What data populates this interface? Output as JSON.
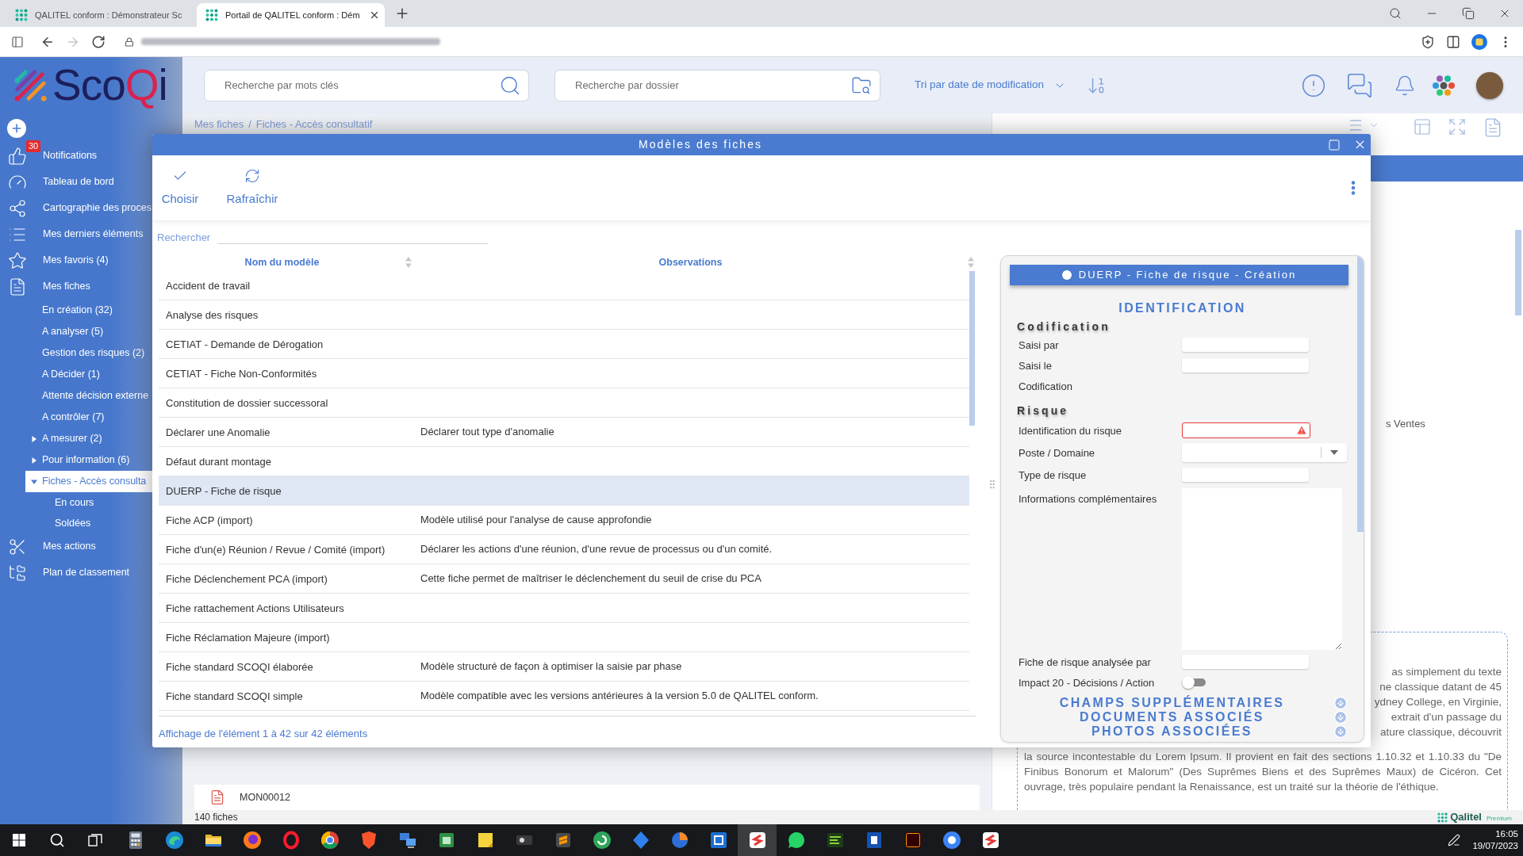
{
  "browser": {
    "tabs": [
      {
        "title": "QALITEL conform : Démonstrateur Sc",
        "selected": false
      },
      {
        "title": "Portail de QALITEL conform : Dém",
        "selected": true
      }
    ],
    "nav": [
      {
        "kind": "back",
        "disabled": false
      },
      {
        "kind": "forward",
        "disabled": true
      },
      {
        "kind": "reload",
        "disabled": false
      }
    ]
  },
  "header": {
    "logo": [
      {
        "text": "Sco",
        "color": "#1c1f5a"
      },
      {
        "text": "Q",
        "color": "#d8234f"
      },
      {
        "text": "i",
        "color": "#1c1f5a"
      }
    ],
    "keyword_search": {
      "placeholder": "Recherche par mots clés"
    },
    "folder_search": {
      "placeholder": "Recherche par dossier"
    },
    "sort": {
      "label": "Tri par date de modification"
    }
  },
  "sidebar": {
    "items": [
      {
        "label": "Notifications",
        "badge": "30",
        "selected": false
      },
      {
        "label": "Tableau de bord",
        "selected": false
      },
      {
        "label": "Cartographie des proces",
        "selected": false
      },
      {
        "label": "Mes derniers éléments",
        "selected": false
      },
      {
        "label": "Mes favoris (4)",
        "selected": false
      },
      {
        "label": "Mes fiches",
        "selected": false,
        "children": [
          {
            "label": "En création (32)",
            "selected": false
          },
          {
            "label": "A analyser (5)",
            "selected": false
          },
          {
            "label": "Gestion des risques (2)",
            "selected": false
          },
          {
            "label": "A Décider (1)",
            "selected": false
          },
          {
            "label": "Attente décision externe",
            "selected": false
          },
          {
            "label": "A contrôler (7)",
            "selected": false
          },
          {
            "label": "A mesurer (2)",
            "selected": false,
            "expanded": false
          },
          {
            "label": "Pour information (6)",
            "selected": false,
            "expanded": false
          },
          {
            "label": "Fiches - Accès consulta",
            "selected": true,
            "expanded": true,
            "children": [
              {
                "label": "En cours",
                "selected": false
              },
              {
                "label": "Soldées",
                "selected": false
              }
            ]
          }
        ]
      },
      {
        "label": "Mes actions",
        "selected": false
      },
      {
        "label": "Plan de classement",
        "selected": false
      }
    ]
  },
  "content": {
    "breadcrumb": {
      "items": [
        "Mes fiches",
        "Fiches - Accès consultatif"
      ],
      "separator": "/"
    },
    "card": {
      "code": "MON00012"
    },
    "count": "140 fiches",
    "detail": {
      "fragment": "s Ventes",
      "text_fragments": [
        "as simplement du texte",
        "ne classique datant de 45",
        "ydney College, en Virginie,",
        "extrait d'un passage du",
        "ature classique, découvrit"
      ],
      "paragraph": "la source incontestable du Lorem Ipsum. Il provient en fait des sections 1.10.32 et 1.10.33 du \"De Finibus Bonorum et Malorum\" (Des Suprêmes Biens et des Suprêmes Maux) de Cicéron. Cet ouvrage, très populaire pendant la Renaissance, est un traité sur la théorie de l'éthique."
    },
    "brand": {
      "name": "Qalitel",
      "tier": "Premium"
    }
  },
  "modal": {
    "title": "Modèles des fiches",
    "toolbar": [
      {
        "label": "Choisir"
      },
      {
        "label": "Rafraîchir"
      }
    ],
    "search": {
      "label": "Rechercher"
    },
    "table": {
      "columns": [
        "Nom du modèle",
        "Observations"
      ],
      "rows": [
        {
          "name": "Accident de travail",
          "selected": false
        },
        {
          "name": "Analyse des risques",
          "selected": false
        },
        {
          "name": "CETIAT - Demande de Dérogation",
          "selected": false
        },
        {
          "name": "CETIAT - Fiche Non-Conformités",
          "selected": false
        },
        {
          "name": "Constitution de dossier successoral",
          "selected": false
        },
        {
          "name": "Déclarer une Anomalie",
          "observations": "Déclarer tout type d'anomalie",
          "selected": false
        },
        {
          "name": "Défaut durant montage",
          "selected": false
        },
        {
          "name": "DUERP - Fiche de risque",
          "selected": true
        },
        {
          "name": "Fiche ACP (import)",
          "observations": "Modèle utilisé pour l'analyse de cause approfondie",
          "selected": false
        },
        {
          "name": "Fiche d'un(e) Réunion / Revue / Comité (import)",
          "observations": "Déclarer les actions d'une réunion, d'une revue de processus ou d'un comité.",
          "selected": false
        },
        {
          "name": "Fiche Déclenchement PCA (import)",
          "observations": "Cette fiche permet de maîtriser le déclenchement du seuil de crise du PCA",
          "selected": false
        },
        {
          "name": "Fiche rattachement Actions Utilisateurs",
          "selected": false
        },
        {
          "name": "Fiche Réclamation Majeure (import)",
          "selected": false
        },
        {
          "name": "Fiche standard SCOQI élaborée",
          "observations": "Modèle structuré de façon à optimiser la saisie par phase",
          "selected": false
        },
        {
          "name": "Fiche standard SCOQI simple",
          "observations": "Modèle compatible avec les versions antérieures à la version 5.0 de QALITEL conform.",
          "selected": false
        }
      ]
    },
    "footer": "Affichage de l'élément 1 à 42 sur 42 éléments",
    "preview": {
      "title": "DUERP - Fiche de risque - Création",
      "section": "IDENTIFICATION",
      "groups": [
        {
          "heading": "Codification",
          "fields": [
            {
              "label": "Saisi par",
              "kind": "text",
              "error": false
            },
            {
              "label": "Saisi le",
              "kind": "text",
              "error": false
            },
            {
              "label": "Codification",
              "kind": "label"
            }
          ]
        },
        {
          "heading": "Risque",
          "fields": [
            {
              "label": "Identification du risque",
              "kind": "text",
              "error": true
            },
            {
              "label": "Poste / Domaine",
              "kind": "select"
            },
            {
              "label": "Type de risque",
              "kind": "text",
              "error": false
            },
            {
              "label": "Informations complémentaires",
              "kind": "textarea"
            },
            {
              "label": "Fiche de risque analysée par",
              "kind": "text",
              "error": false
            },
            {
              "label": "Impact 20 - Décisions / Action",
              "kind": "toggle",
              "on": false
            }
          ]
        }
      ],
      "more_sections": [
        "CHAMPS SUPPLÉMENTAIRES",
        "DOCUMENTS ASSOCIÉS",
        "PHOTOS ASSOCIÉES"
      ]
    }
  },
  "taskbar": {
    "apps": [
      {
        "kind": "calculator",
        "selected": false
      },
      {
        "kind": "round-teal",
        "selected": false
      },
      {
        "kind": "folder",
        "selected": false
      },
      {
        "kind": "round-orange",
        "selected": false
      },
      {
        "kind": "ring-red",
        "selected": false
      },
      {
        "kind": "round-multi",
        "selected": false
      },
      {
        "kind": "shield-orange",
        "selected": false
      },
      {
        "kind": "computer",
        "selected": false
      },
      {
        "kind": "tile-green",
        "selected": false
      },
      {
        "kind": "note",
        "selected": false
      },
      {
        "kind": "tile-dark",
        "selected": false
      },
      {
        "kind": "tile-orange",
        "selected": false
      },
      {
        "kind": "round-green",
        "selected": false
      },
      {
        "kind": "diamond",
        "selected": false
      },
      {
        "kind": "round-swirl",
        "selected": false
      },
      {
        "kind": "tile-blue",
        "selected": false
      },
      {
        "kind": "tile-red",
        "selected": true
      },
      {
        "kind": "bubble",
        "selected": false
      },
      {
        "kind": "tile-lime",
        "selected": false
      },
      {
        "kind": "tile-navy",
        "selected": false
      },
      {
        "kind": "tile-maroon",
        "selected": false
      },
      {
        "kind": "round-blue",
        "selected": false
      },
      {
        "kind": "tile-red",
        "selected": false
      }
    ],
    "time": "16:05",
    "date": "19/07/2023"
  }
}
